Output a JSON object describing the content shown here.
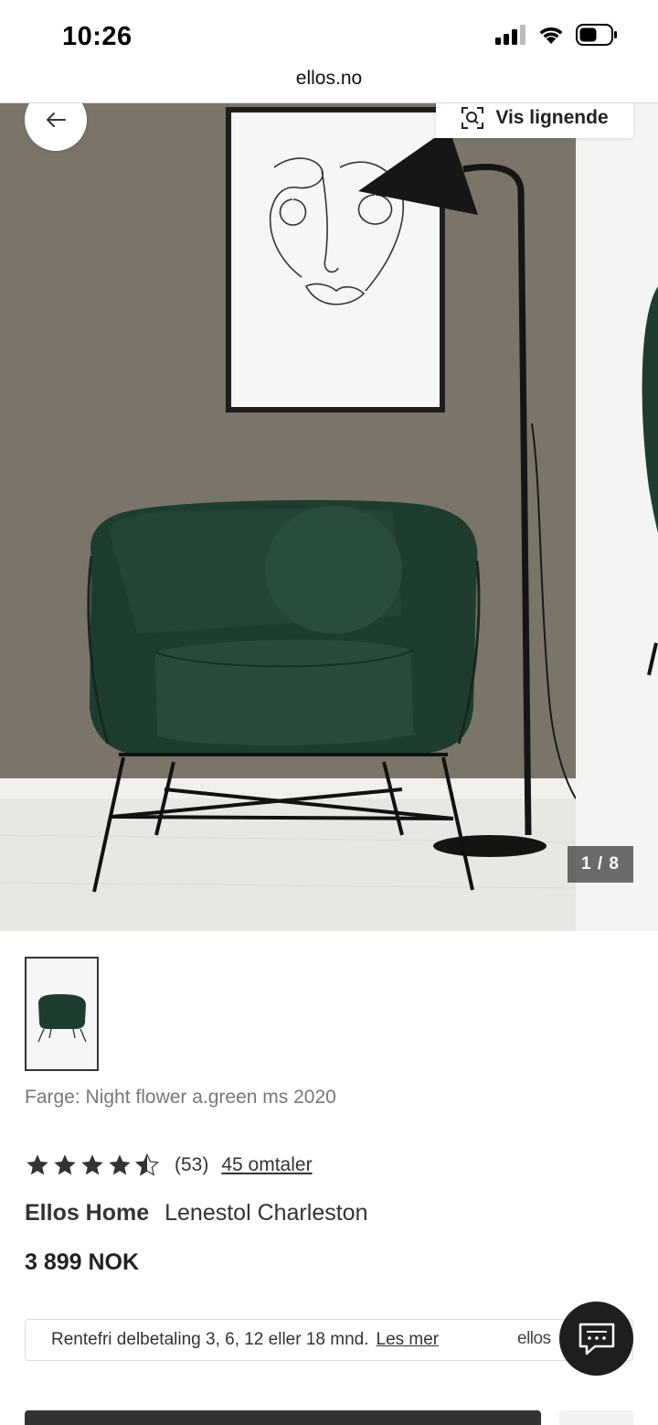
{
  "status_bar": {
    "time": "10:26"
  },
  "browser": {
    "url": "ellos.no"
  },
  "gallery": {
    "similar_label": "Vis lignende",
    "counter": "1 / 8"
  },
  "product": {
    "color_label": "Farge: Night flower a.green ms 2020",
    "rating": {
      "stars": 4.5,
      "count_text": "(53)",
      "reviews_link": "45 omtaler"
    },
    "brand": "Ellos Home",
    "name": "Lenestol Charleston",
    "price": "3 899 NOK"
  },
  "financing": {
    "text": "Rentefri delbetaling 3, 6, 12 eller 18 mnd.",
    "link": "Les mer",
    "logo_text": "ellos"
  },
  "icons": {
    "back": "arrow-left-icon",
    "similar": "visual-search-icon",
    "chat": "chat-bubble-icon"
  },
  "colors": {
    "wall": "#7a7468",
    "chair": "#1f3d2f",
    "floor": "#e9e8e4"
  }
}
